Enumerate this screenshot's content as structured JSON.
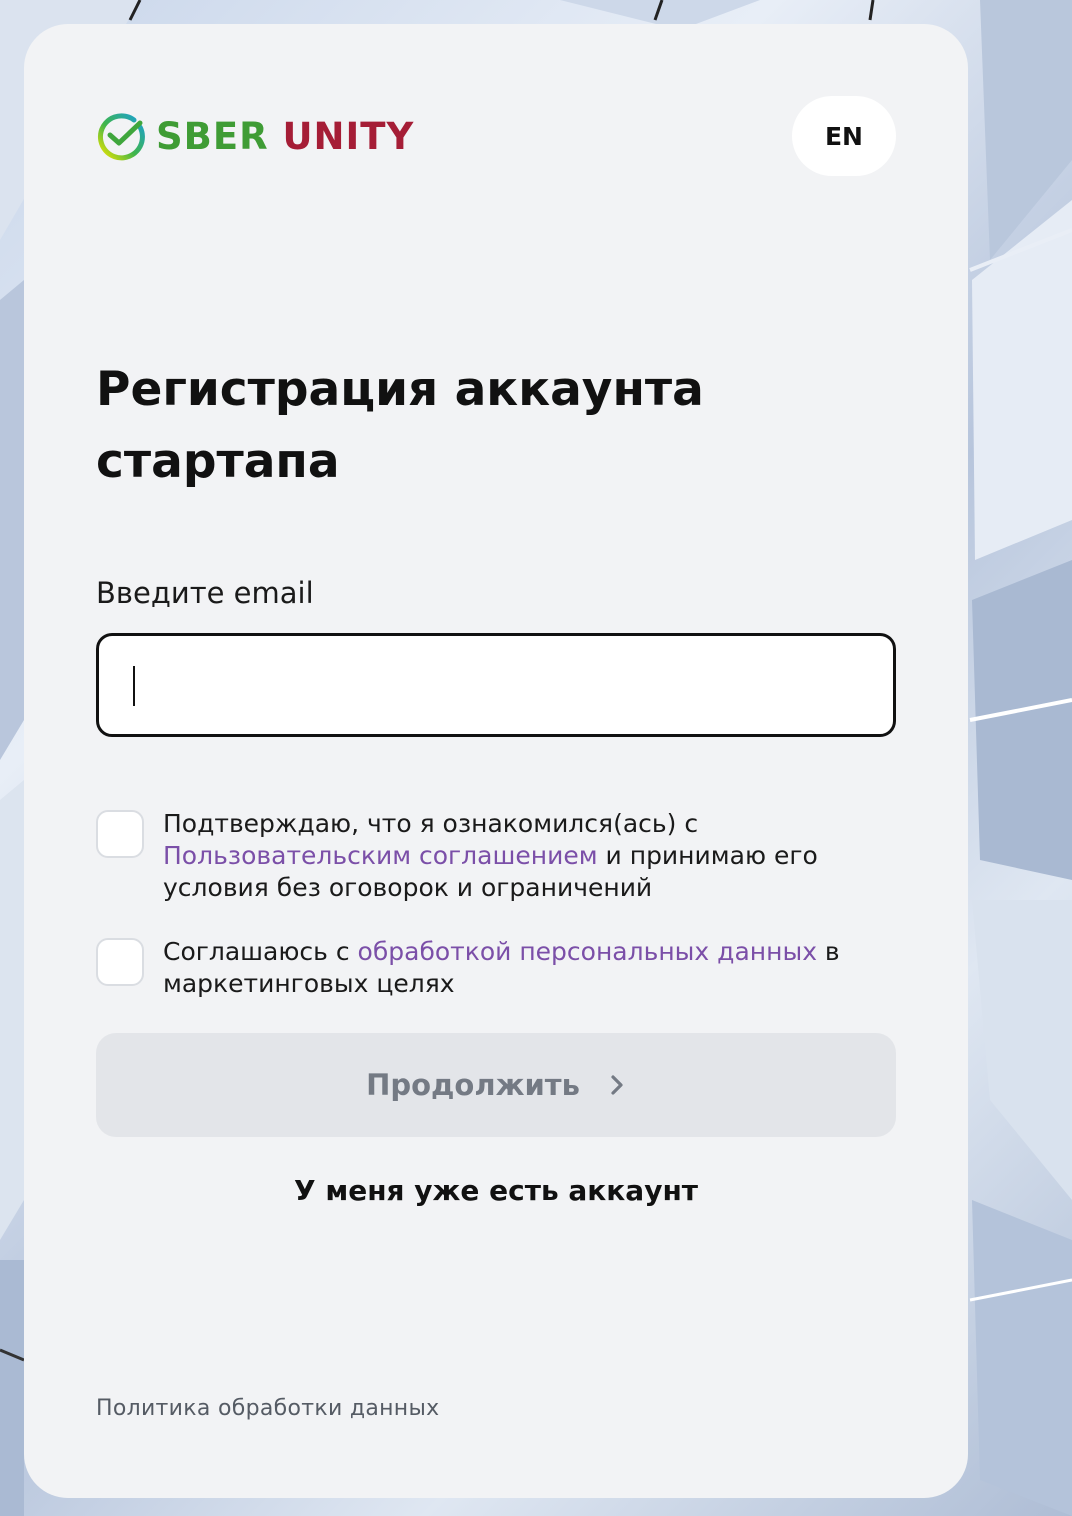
{
  "header": {
    "logo_brand": "SBER",
    "logo_product": "UNITY",
    "lang_button": "EN"
  },
  "form": {
    "title": "Регистрация аккаунта стартапа",
    "email_label": "Введите email",
    "email_value": "",
    "consent_terms": {
      "prefix": "Подтверждаю, что я ознакомился(ась) с ",
      "link": "Пользовательским соглашением",
      "suffix": " и принимаю его условия без оговорок и ограничений",
      "checked": false
    },
    "consent_marketing": {
      "prefix": "Соглашаюсь с ",
      "link": "обработкой персональных данных",
      "suffix": " в маркетинговых целях",
      "checked": false
    },
    "continue_button": "Продолжить",
    "have_account_link": "У меня уже есть аккаунт"
  },
  "footer": {
    "policy_link": "Политика обработки данных"
  },
  "colors": {
    "sber_green": "#3f9c35",
    "unity_red": "#a51d36",
    "link_purple": "#7b4fa8",
    "card_bg": "#f2f3f5",
    "disabled_button_bg": "#e3e5e9"
  },
  "icons": {
    "logo": "sber-check-circle-icon",
    "continue": "chevron-right-icon"
  }
}
